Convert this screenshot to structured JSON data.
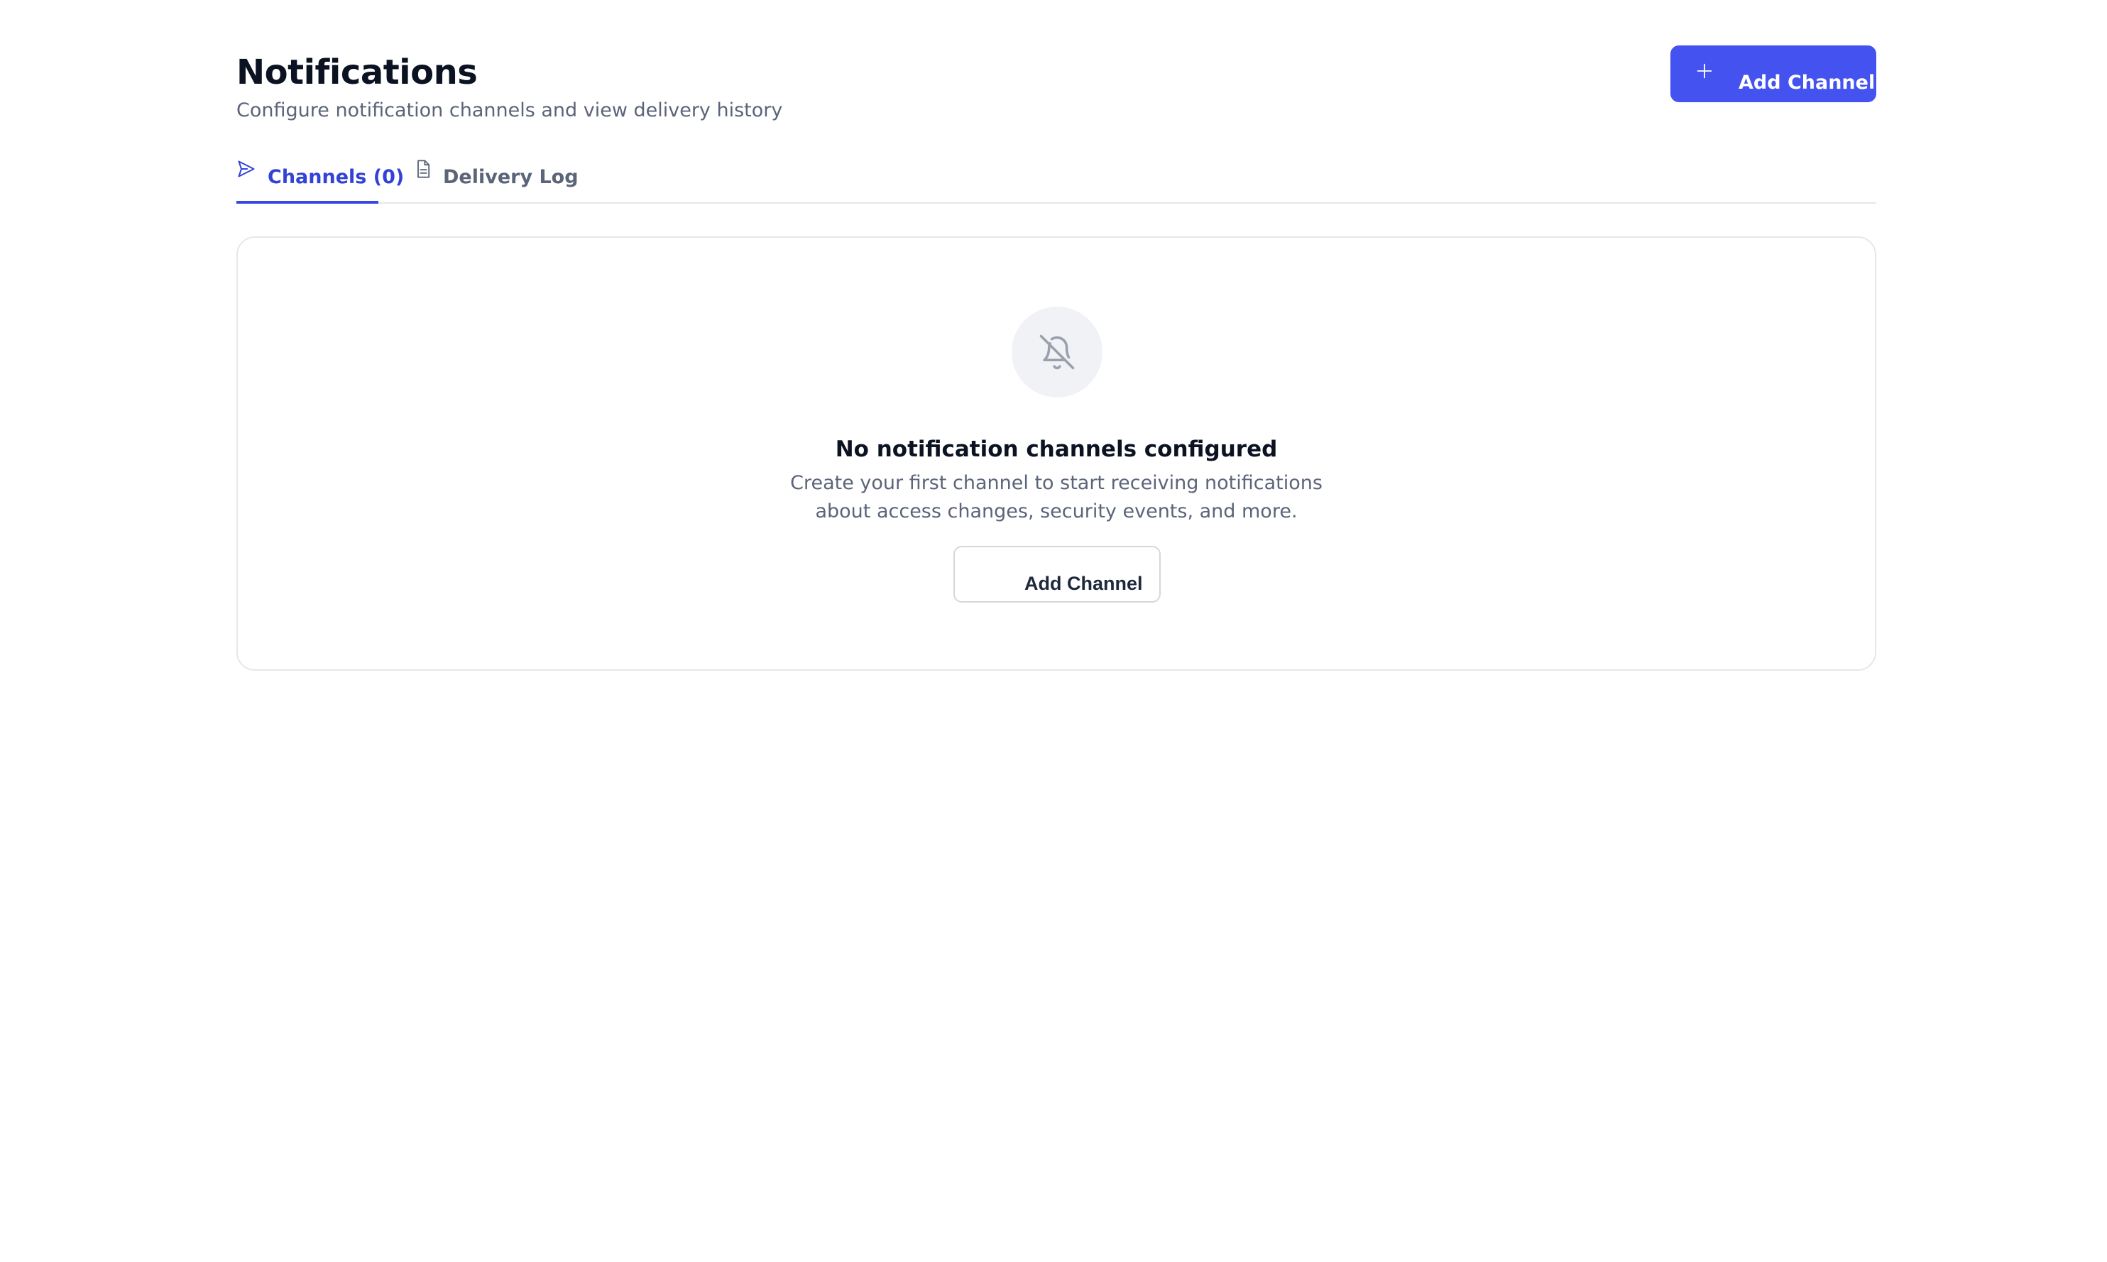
{
  "header": {
    "title": "Notifications",
    "subtitle": "Configure notification channels and view delivery history",
    "add_button_label": "Add Channel"
  },
  "tabs": [
    {
      "label": "Channels (0)",
      "icon": "send-icon",
      "active": true
    },
    {
      "label": "Delivery Log",
      "icon": "file-text-icon",
      "active": false
    }
  ],
  "empty_state": {
    "icon": "bell-off-icon",
    "title": "No notification channels configured",
    "description": "Create your first channel to start receiving notifications about access changes, security events, and more.",
    "button_label": "Add Channel"
  },
  "colors": {
    "accent": "#4452ef",
    "active_tab": "#3342d6",
    "text_primary": "#0b1222",
    "text_muted": "#5b6478",
    "border": "#e5e7eb"
  }
}
